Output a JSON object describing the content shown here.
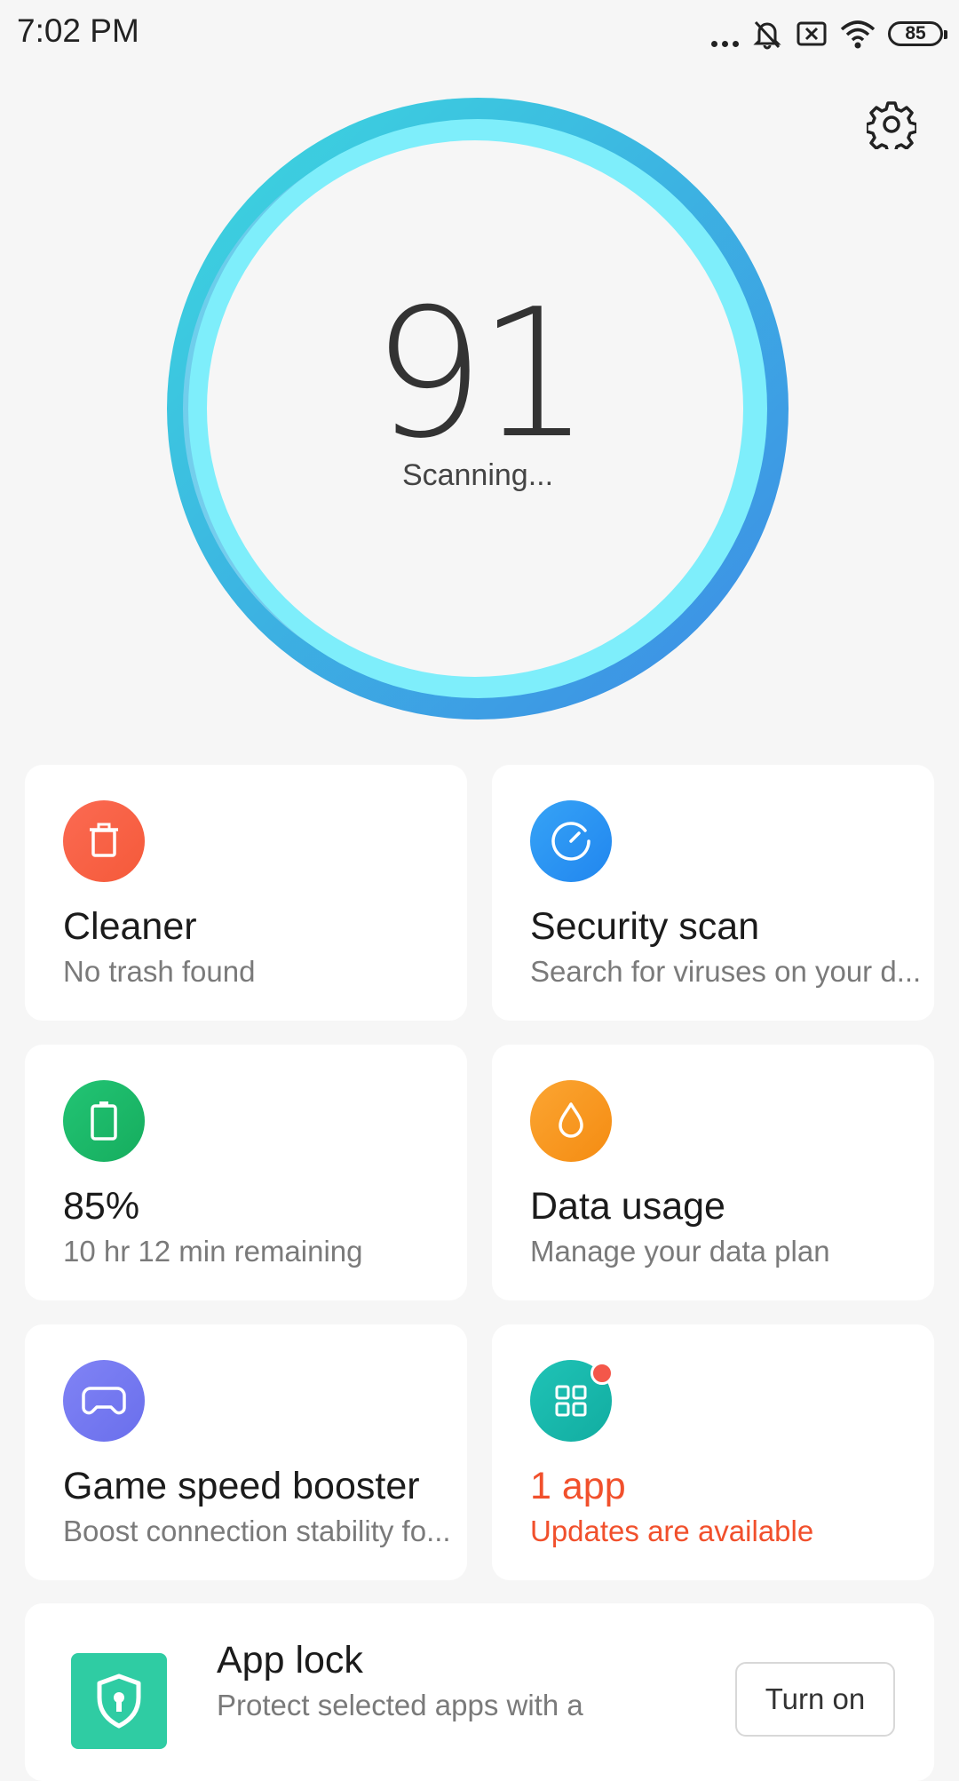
{
  "status_bar": {
    "time": "7:02 PM",
    "battery_level": "85",
    "icons": [
      "more-dots-icon",
      "bell-muted-icon",
      "no-sim-icon",
      "wifi-icon",
      "battery-icon"
    ]
  },
  "header": {
    "settings_icon": "gear-icon"
  },
  "score": {
    "value": "91",
    "status": "Scanning...",
    "colors": {
      "ring_start": "#3dd6df",
      "ring_end": "#3d8fe8",
      "inner": "#7ef0f8"
    }
  },
  "cards": [
    {
      "id": "cleaner",
      "icon": "trash-icon",
      "color": "#f86549",
      "title": "Cleaner",
      "subtitle": "No trash found"
    },
    {
      "id": "security",
      "icon": "speedometer-icon",
      "color": "#2c95f3",
      "title": "Security scan",
      "subtitle": "Search for viruses on your d..."
    },
    {
      "id": "battery",
      "icon": "battery-icon",
      "color": "#1fbd69",
      "title": "85%",
      "subtitle": "10 hr 12 min  remaining"
    },
    {
      "id": "data",
      "icon": "droplet-icon",
      "color": "#f99a20",
      "title": "Data usage",
      "subtitle": "Manage your data plan"
    },
    {
      "id": "game",
      "icon": "gamepad-icon",
      "color": "#7479f0",
      "title": "Game speed booster",
      "subtitle": "Boost connection stability fo..."
    },
    {
      "id": "apps",
      "icon": "apps-grid-icon",
      "color": "#18b9ad",
      "title": "1 app",
      "subtitle": "Updates are available",
      "alert_color": "#f1502c"
    }
  ],
  "app_lock": {
    "icon": "shield-lock-icon",
    "title": "App lock",
    "subtitle": "Protect selected apps with a",
    "button": "Turn on"
  }
}
